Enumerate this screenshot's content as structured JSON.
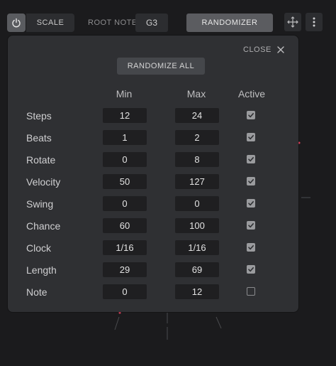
{
  "toolbar": {
    "power_icon": "power-icon",
    "scale_label": "SCALE",
    "root_note_label": "ROOT NOTE",
    "root_note_value": "G3",
    "randomizer_label": "RANDOMIZER",
    "move_icon": "move-arrows-icon",
    "more_icon": "vertical-dots-icon"
  },
  "panel": {
    "close_label": "CLOSE",
    "close_icon": "close-icon",
    "randomize_all_label": "RANDOMIZE ALL",
    "headers": {
      "min": "Min",
      "max": "Max",
      "active": "Active"
    },
    "rows": [
      {
        "label": "Steps",
        "min": "12",
        "max": "24",
        "active": true
      },
      {
        "label": "Beats",
        "min": "1",
        "max": "2",
        "active": true
      },
      {
        "label": "Rotate",
        "min": "0",
        "max": "8",
        "active": true
      },
      {
        "label": "Velocity",
        "min": "50",
        "max": "127",
        "active": true
      },
      {
        "label": "Swing",
        "min": "0",
        "max": "0",
        "active": true
      },
      {
        "label": "Chance",
        "min": "60",
        "max": "100",
        "active": true
      },
      {
        "label": "Clock",
        "min": "1/16",
        "max": "1/16",
        "active": true
      },
      {
        "label": "Length",
        "min": "29",
        "max": "69",
        "active": true
      },
      {
        "label": "Note",
        "min": "0",
        "max": "12",
        "active": false
      }
    ]
  },
  "colors": {
    "background": "#1b1b1d",
    "panel": "#2f3033",
    "field": "#1f1f21",
    "accent_pink": "#e0405c"
  }
}
